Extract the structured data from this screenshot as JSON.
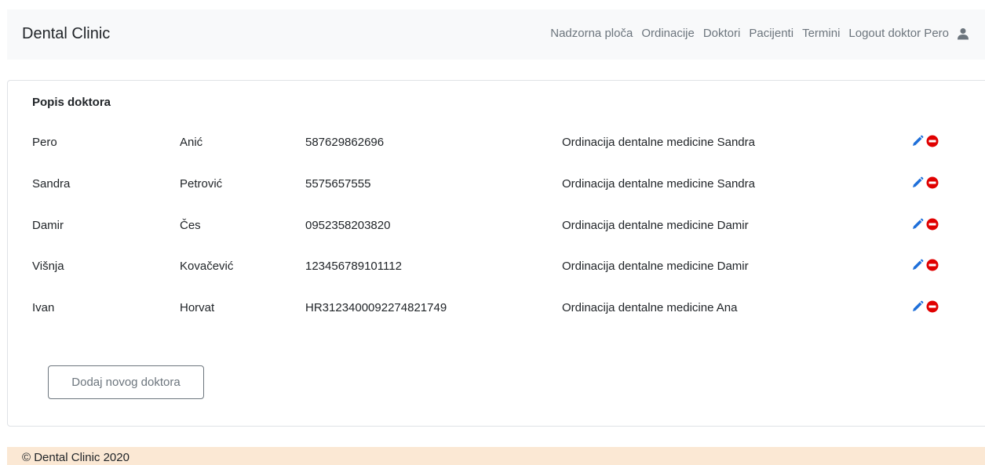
{
  "navbar": {
    "brand": "Dental Clinic",
    "links": [
      "Nadzorna ploča",
      "Ordinacije",
      "Doktori",
      "Pacijenti",
      "Termini",
      "Logout doktor Pero"
    ],
    "user_icon": "user-icon"
  },
  "doctors": {
    "title": "Popis doktora",
    "rows": [
      {
        "first_name": "Pero",
        "last_name": "Anić",
        "oib": "587629862696",
        "clinic": "Ordinacija dentalne medicine Sandra"
      },
      {
        "first_name": "Sandra",
        "last_name": "Petrović",
        "oib": "5575657555",
        "clinic": "Ordinacija dentalne medicine Sandra"
      },
      {
        "first_name": "Damir",
        "last_name": "Čes",
        "oib": "0952358203820",
        "clinic": "Ordinacija dentalne medicine Damir"
      },
      {
        "first_name": "Višnja",
        "last_name": "Kovačević",
        "oib": "123456789101112",
        "clinic": "Ordinacija dentalne medicine Damir"
      },
      {
        "first_name": "Ivan",
        "last_name": "Horvat",
        "oib": "HR3123400092274821749",
        "clinic": "Ordinacija dentalne medicine Ana"
      }
    ],
    "row_actions": [
      "edit-pencil-icon",
      "delete-minus-circle-icon"
    ],
    "add_button_label": "Dodaj novog doktora"
  },
  "footer": {
    "text": "© Dental Clinic 2020"
  },
  "colors": {
    "navbar_bg": "#f8f9fa",
    "nav_link": "#6c757d",
    "edit_icon": "#1e6fd9",
    "delete_icon": "#e00000",
    "footer_bg": "#fbe8d4"
  }
}
